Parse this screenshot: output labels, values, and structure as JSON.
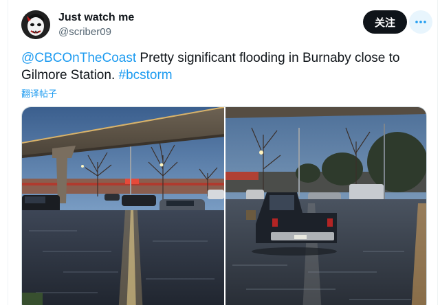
{
  "author": {
    "display_name": "Just watch me",
    "handle": "@scriber09"
  },
  "actions": {
    "follow_label": "关注",
    "more_icon": "more-horizontal-icon"
  },
  "tweet": {
    "mention": "@CBCOnTheCoast",
    "text_part1": " Pretty significant flooding in Burnaby close to Gilmore Station. ",
    "hashtag": "#bcstorm",
    "translate_label": "翻译帖子"
  },
  "media": {
    "count": 2,
    "photos": [
      "photo-1",
      "photo-2"
    ]
  },
  "colors": {
    "link": "#1d9bf0",
    "follow_bg": "#0f1419",
    "secondary_text": "#536471"
  }
}
